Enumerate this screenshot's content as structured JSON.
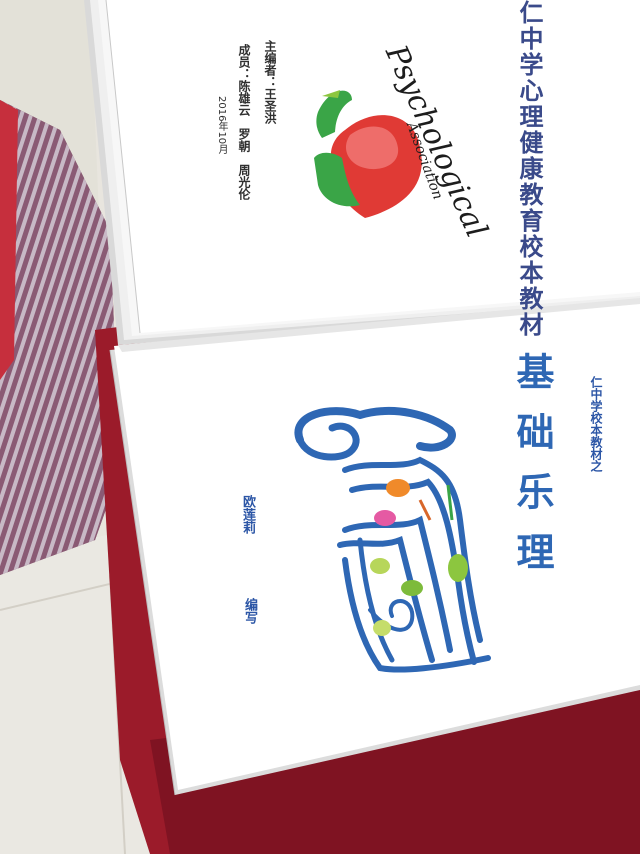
{
  "psychology_book": {
    "title": "仁中学心理健康教育校本教材",
    "editors": "主编者：王圣洪",
    "members": "成员：陈雄云　罗朝　周光伦",
    "date": "2016年10月",
    "logo_text_main": "Psychological",
    "logo_text_sub": "Association"
  },
  "music_book": {
    "series": "仁中学校本教材之",
    "title": "基础乐理",
    "author": "欧莲莉",
    "role": "编写"
  },
  "colors": {
    "music_blue": "#2e67b4",
    "heart_red": "#e03a35",
    "leaf_green": "#3aa547",
    "cloth_red": "#9b1b2a"
  },
  "icons": [
    "heart-logo-icon",
    "treble-clef-staff-icon"
  ]
}
